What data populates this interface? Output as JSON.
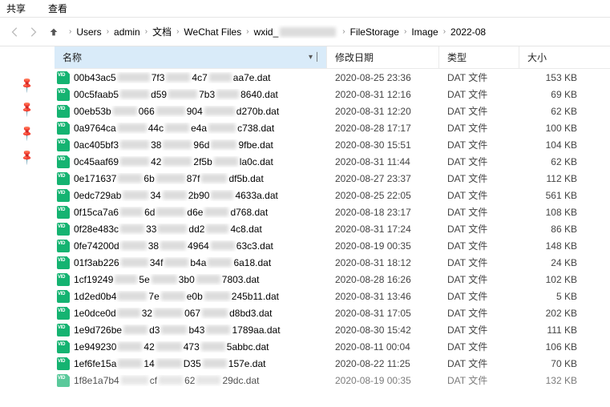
{
  "menubar": {
    "items": [
      "共享",
      "查看"
    ]
  },
  "nav": {
    "disabled_arrows": true
  },
  "breadcrumb": [
    "Users",
    "admin",
    "文档",
    "WeChat Files",
    "wxid_▇▇▇▇▇▇▇▇",
    "FileStorage",
    "Image",
    "2022-08"
  ],
  "columns": {
    "name": "名称",
    "date": "修改日期",
    "type": "类型",
    "size": "大小"
  },
  "type_label": "DAT 文件",
  "files": [
    {
      "p": "00b43ac5",
      "m1": 40,
      "mid": "7f3",
      "m2": 30,
      "mid2": "4c7",
      "m3": 28,
      "suf": "aa7e.dat",
      "date": "2020-08-25 23:36",
      "size": "153 KB"
    },
    {
      "p": "00c5faab5",
      "m1": 36,
      "mid": "d59",
      "m2": 36,
      "mid2": "7b3",
      "m3": 28,
      "suf": "8640.dat",
      "date": "2020-08-31 12:16",
      "size": "69 KB"
    },
    {
      "p": "00eb53b",
      "m1": 30,
      "mid": "066",
      "m2": 36,
      "mid2": "904",
      "m3": 38,
      "suf": "d270b.dat",
      "date": "2020-08-31 12:20",
      "size": "62 KB"
    },
    {
      "p": "0a9764ca",
      "m1": 36,
      "mid": "44c",
      "m2": 30,
      "mid2": "e4a",
      "m3": 34,
      "suf": "c738.dat",
      "date": "2020-08-28 17:17",
      "size": "100 KB"
    },
    {
      "p": "0ac405bf3",
      "m1": 36,
      "mid": "38",
      "m2": 36,
      "mid2": "96d",
      "m3": 32,
      "suf": "9fbe.dat",
      "date": "2020-08-30 15:51",
      "size": "104 KB"
    },
    {
      "p": "0c45aaf69",
      "m1": 36,
      "mid": "42",
      "m2": 36,
      "mid2": "2f5b",
      "m3": 30,
      "suf": "la0c.dat",
      "date": "2020-08-31 11:44",
      "size": "62 KB"
    },
    {
      "p": "0e171637",
      "m1": 30,
      "mid": "6b",
      "m2": 36,
      "mid2": "87f",
      "m3": 32,
      "suf": "df5b.dat",
      "date": "2020-08-27 23:37",
      "size": "112 KB"
    },
    {
      "p": "0edc729ab",
      "m1": 32,
      "mid": "34",
      "m2": 30,
      "mid2": "2b90",
      "m3": 28,
      "suf": "4633a.dat",
      "date": "2020-08-25 22:05",
      "size": "561 KB"
    },
    {
      "p": "0f15ca7a6",
      "m1": 28,
      "mid": "6d",
      "m2": 36,
      "mid2": "d6e",
      "m3": 30,
      "suf": "d768.dat",
      "date": "2020-08-18 23:17",
      "size": "108 KB"
    },
    {
      "p": "0f28e483c",
      "m1": 30,
      "mid": "33",
      "m2": 36,
      "mid2": "dd2",
      "m3": 28,
      "suf": "4c8.dat",
      "date": "2020-08-31 17:24",
      "size": "86 KB"
    },
    {
      "p": "0fe74200d",
      "m1": 32,
      "mid": "38",
      "m2": 32,
      "mid2": "4964",
      "m3": 30,
      "suf": "63c3.dat",
      "date": "2020-08-19 00:35",
      "size": "148 KB"
    },
    {
      "p": "01f3ab226",
      "m1": 34,
      "mid": "34f",
      "m2": 30,
      "mid2": "b4a",
      "m3": 30,
      "suf": "6a18.dat",
      "date": "2020-08-31 18:12",
      "size": "24 KB"
    },
    {
      "p": "1cf19249",
      "m1": 28,
      "mid": "5e",
      "m2": 32,
      "mid2": "3b0",
      "m3": 30,
      "suf": "7803.dat",
      "date": "2020-08-28 16:26",
      "size": "102 KB"
    },
    {
      "p": "1d2ed0b4",
      "m1": 36,
      "mid": "7e",
      "m2": 30,
      "mid2": "e0b",
      "m3": 32,
      "suf": "245b11.dat",
      "date": "2020-08-31 13:46",
      "size": "5 KB"
    },
    {
      "p": "1e0dce0d",
      "m1": 28,
      "mid": "32",
      "m2": 36,
      "mid2": "067",
      "m3": 32,
      "suf": "d8bd3.dat",
      "date": "2020-08-31 17:05",
      "size": "202 KB"
    },
    {
      "p": "1e9d726be",
      "m1": 30,
      "mid": "d3",
      "m2": 32,
      "mid2": "b43",
      "m3": 30,
      "suf": "1789aa.dat",
      "date": "2020-08-30 15:42",
      "size": "111 KB"
    },
    {
      "p": "1e949230",
      "m1": 30,
      "mid": "42",
      "m2": 32,
      "mid2": "473",
      "m3": 30,
      "suf": "5abbc.dat",
      "date": "2020-08-11 00:04",
      "size": "106 KB"
    },
    {
      "p": "1ef6fe15a",
      "m1": 30,
      "mid": "14",
      "m2": 32,
      "mid2": "D35",
      "m3": 30,
      "suf": "157e.dat",
      "date": "2020-08-22 11:25",
      "size": "70 KB"
    },
    {
      "p": "1f8e1a7b4",
      "m1": 34,
      "mid": "cf",
      "m2": 30,
      "mid2": "62",
      "m3": 30,
      "suf": "29dc.dat",
      "date": "2020-08-19 00:35",
      "size": "132 KB"
    }
  ]
}
